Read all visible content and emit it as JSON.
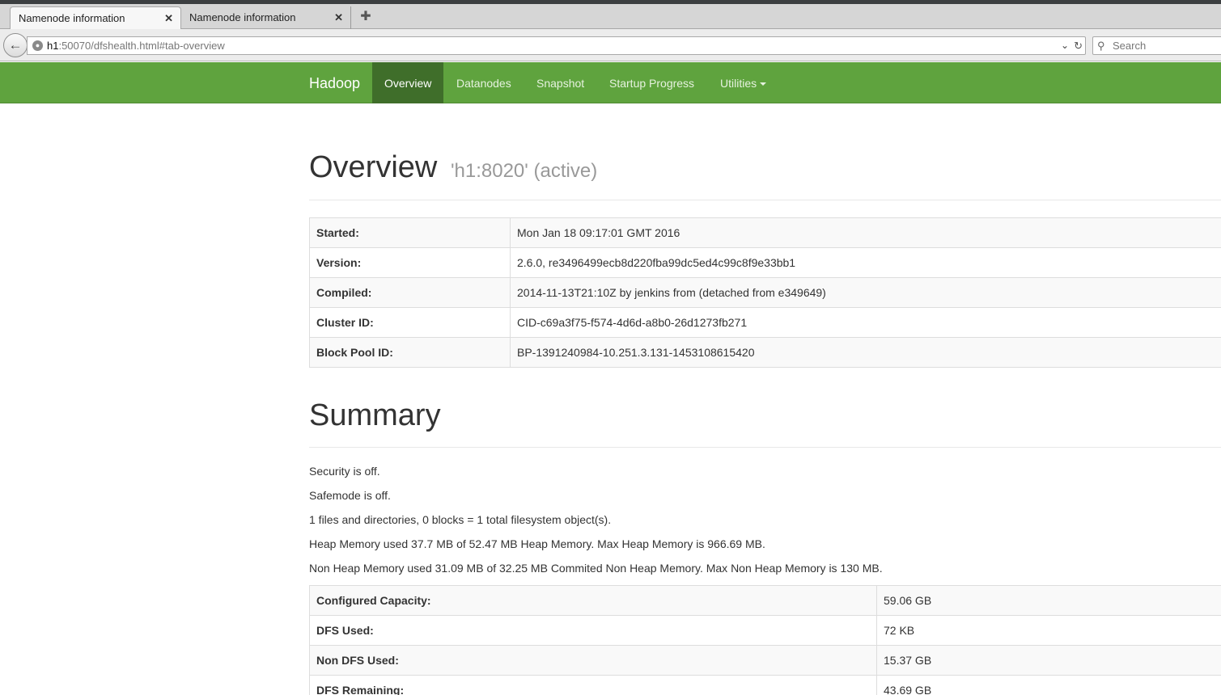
{
  "browser": {
    "tabs": [
      {
        "label": "Namenode information",
        "active": true
      },
      {
        "label": "Namenode information",
        "active": false
      }
    ],
    "url_host": "h1",
    "url_rest": ":50070/dfshealth.html#tab-overview",
    "search_placeholder": "Search"
  },
  "navbar": {
    "brand": "Hadoop",
    "items": [
      "Overview",
      "Datanodes",
      "Snapshot",
      "Startup Progress",
      "Utilities"
    ],
    "active": "Overview",
    "colors": {
      "bar": "#5fa33e",
      "active": "#3f6e2a"
    }
  },
  "overview": {
    "title": "Overview",
    "subtitle": "'h1:8020' (active)",
    "rows": [
      {
        "key": "Started:",
        "value": "Mon Jan 18 09:17:01 GMT 2016"
      },
      {
        "key": "Version:",
        "value": "2.6.0, re3496499ecb8d220fba99dc5ed4c99c8f9e33bb1"
      },
      {
        "key": "Compiled:",
        "value": "2014-11-13T21:10Z by jenkins from (detached from e349649)"
      },
      {
        "key": "Cluster ID:",
        "value": "CID-c69a3f75-f574-4d6d-a8b0-26d1273fb271"
      },
      {
        "key": "Block Pool ID:",
        "value": "BP-1391240984-10.251.3.131-1453108615420"
      }
    ]
  },
  "summary": {
    "title": "Summary",
    "lines": [
      "Security is off.",
      "Safemode is off.",
      "1 files and directories, 0 blocks = 1 total filesystem object(s).",
      "Heap Memory used 37.7 MB of 52.47 MB Heap Memory. Max Heap Memory is 966.69 MB.",
      "Non Heap Memory used 31.09 MB of 32.25 MB Commited Non Heap Memory. Max Non Heap Memory is 130 MB."
    ],
    "rows": [
      {
        "key": "Configured Capacity:",
        "value": "59.06 GB"
      },
      {
        "key": "DFS Used:",
        "value": "72 KB"
      },
      {
        "key": "Non DFS Used:",
        "value": "15.37 GB"
      },
      {
        "key": "DFS Remaining:",
        "value": "43.69 GB"
      }
    ]
  }
}
